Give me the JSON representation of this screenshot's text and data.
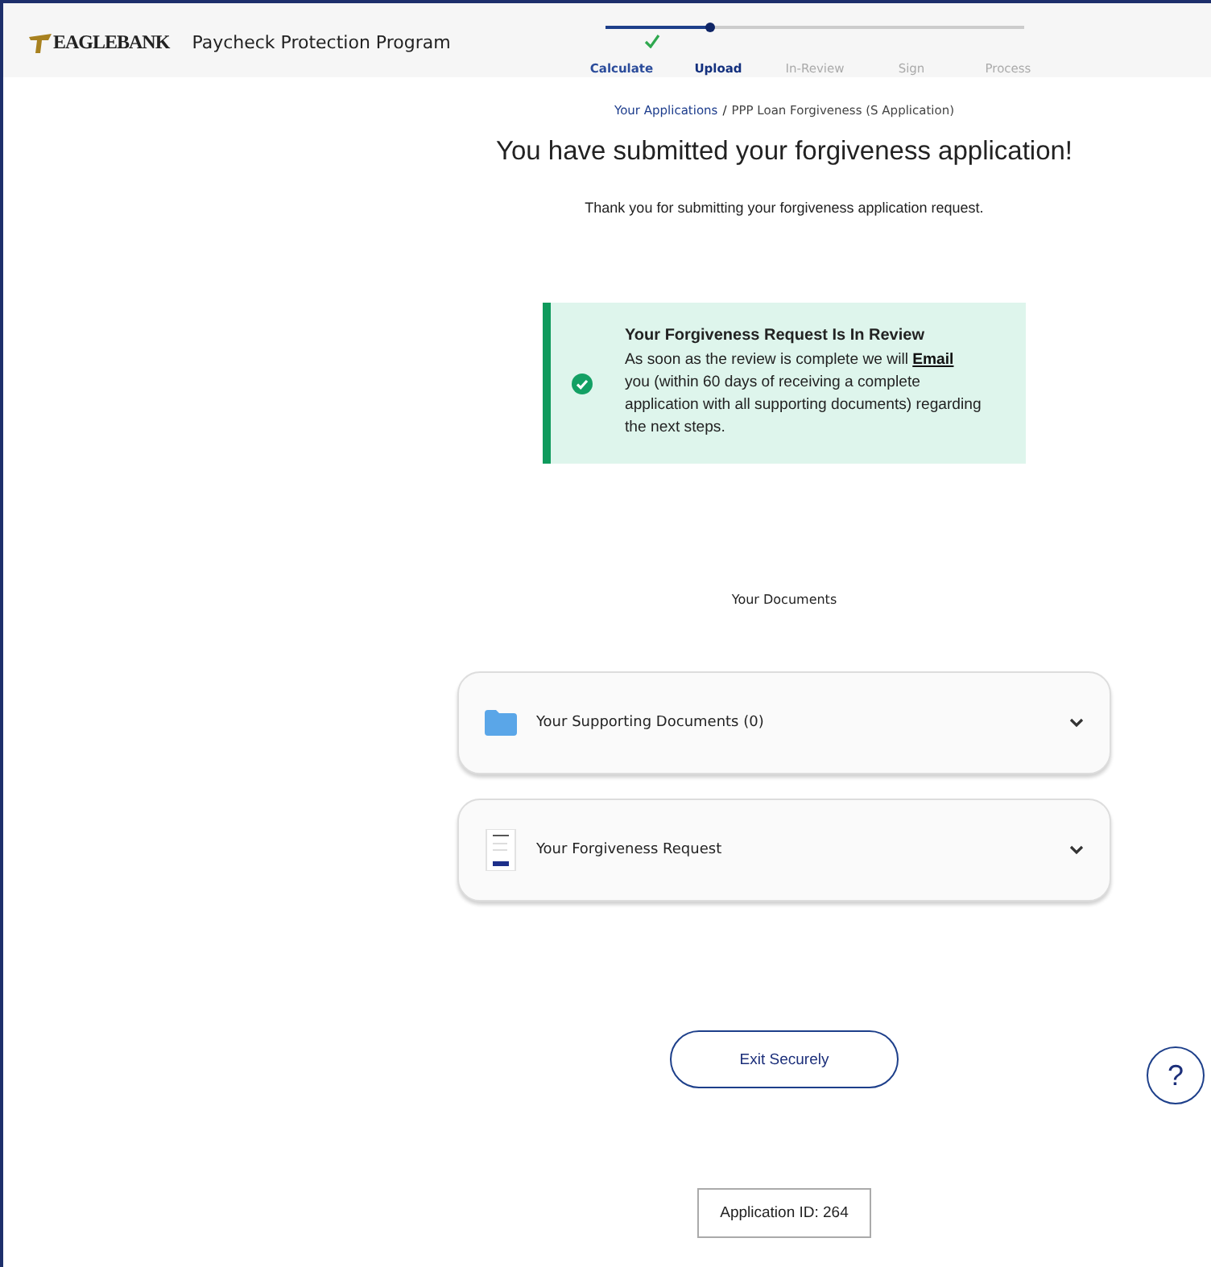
{
  "header": {
    "logo": "EAGLEBANK",
    "title": "Paycheck Protection Program"
  },
  "steps": [
    {
      "label": "Calculate",
      "completed": true,
      "selected": false
    },
    {
      "label": "Upload",
      "completed": false,
      "selected": true
    },
    {
      "label": "In-Review",
      "completed": false,
      "selected": false
    },
    {
      "label": "Sign",
      "completed": false,
      "selected": false
    },
    {
      "label": "Process",
      "completed": false,
      "selected": false
    }
  ],
  "breadcrumb": {
    "link": "Your Applications",
    "separator": "/",
    "current": "PPP Loan Forgiveness (S Application)"
  },
  "heading": "You have submitted your forgiveness application!",
  "subheading": "Thank you for submitting your forgiveness application request.",
  "alert": {
    "title": "Your Forgiveness Request Is In Review",
    "before": "As soon as the review is complete we will",
    "link": "Email",
    "after": "you (within 60 days of receiving a complete application with all supporting documents) regarding the next steps."
  },
  "documents_title": "Your Documents",
  "documents": [
    {
      "kind": "folder",
      "label": "Your Supporting Documents (0)",
      "expanded": false
    },
    {
      "kind": "file",
      "label": "Your Forgiveness Request",
      "expanded": false
    }
  ],
  "exit_button": "Exit Securely",
  "help": "?",
  "application_id": "Application ID: 264"
}
